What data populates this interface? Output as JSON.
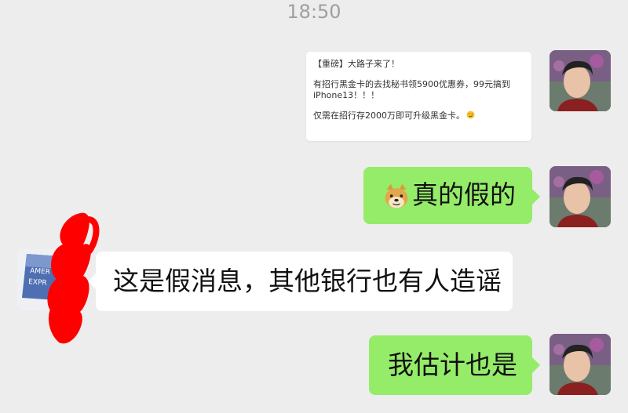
{
  "chat": {
    "timestamp": "18:50",
    "quote_card": {
      "line1": "【重磅】大路子来了！",
      "line2": "有招行黑金卡的去找秘书领5900优惠券，99元搞到",
      "line3": "iPhone13！！！",
      "line4": "仅需在招行存2000万即可升级黑金卡。"
    },
    "messages": [
      {
        "text": "真的假的"
      },
      {
        "text": "这是假消息，其他银行也有人造谣"
      },
      {
        "text": "我估计也是"
      }
    ],
    "partner_avatar_text": [
      "AMER",
      "EXPR"
    ]
  },
  "colors": {
    "background": "#ededed",
    "sent_bubble": "#95ec69",
    "received_bubble": "#ffffff",
    "timestamp": "#9f9f9f",
    "redaction": "#ff0000"
  },
  "icons": [
    "doge-emoji-icon",
    "smirk-emoji-icon"
  ]
}
